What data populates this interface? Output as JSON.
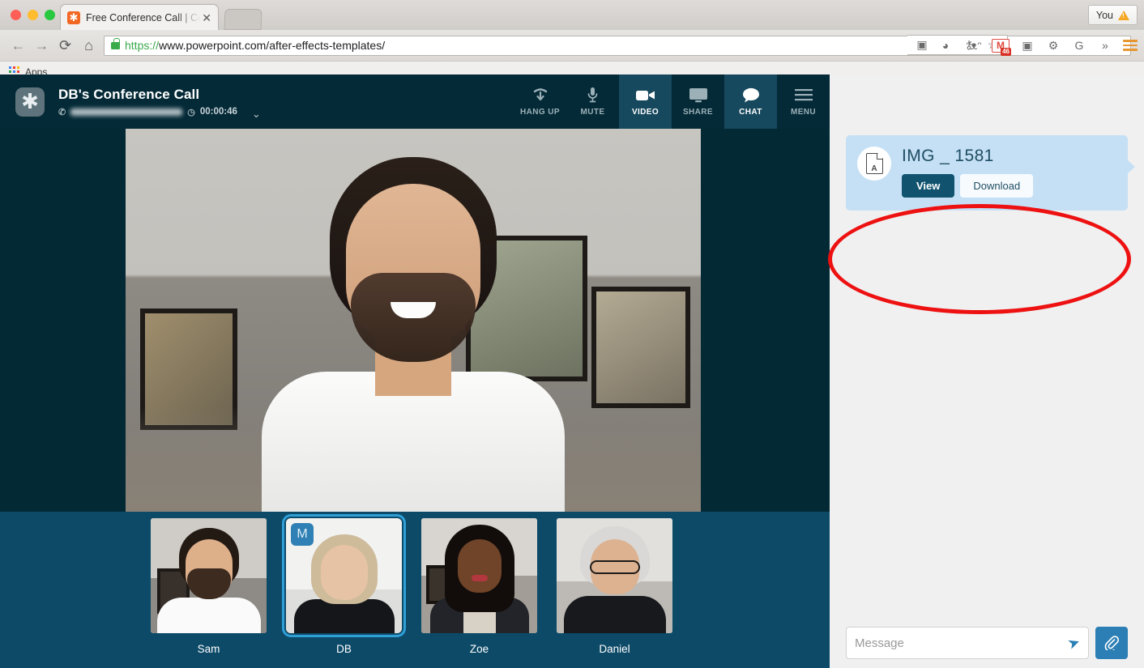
{
  "browser": {
    "tab": {
      "title": "Free Conference Call | Con",
      "favicon_icon": "asterisk-icon",
      "close_icon": "✕"
    },
    "window_controls": [
      "close",
      "minimize",
      "maximize"
    ],
    "profile_button": {
      "label": "You",
      "icon": "warning-triangle-icon"
    },
    "nav": {
      "back_icon": "←",
      "forward_icon": "→",
      "reload_icon": "⟳",
      "home_icon": "⌂"
    },
    "address": {
      "scheme": "https://",
      "rest": "www.powerpoint.com/after-effects-templates/",
      "lock_icon": "lock-icon"
    },
    "omni_icons": [
      "video-cast-icon",
      "profile-block-icon",
      "key-icon",
      "star-icon"
    ],
    "extensions": [
      {
        "name": "doodle-extension-icon",
        "glyph": "ᵔᴥᵔ"
      },
      {
        "name": "gmail-icon",
        "glyph": "M",
        "badge": "46"
      },
      {
        "name": "screenshot-extension-icon",
        "glyph": "▣"
      },
      {
        "name": "settings-gear-icon",
        "glyph": "⚙"
      },
      {
        "name": "google-icon",
        "glyph": "G"
      },
      {
        "name": "overflow-icon",
        "glyph": "»"
      },
      {
        "name": "chrome-menu-icon",
        "glyph": "≡"
      }
    ],
    "bookmarks": {
      "apps_label": "Apps"
    }
  },
  "app": {
    "logo_icon": "asterisk-logo-icon",
    "meeting_title": "DB's Conference Call",
    "phone_number": "",
    "phone_icon": "phone-icon",
    "timer_icon": "clock-icon",
    "timer": "00:00:46",
    "dropdown_icon": "chevron-down-icon",
    "toolbar": [
      {
        "label": "HANG UP",
        "icon": "hang-up-icon",
        "glyph": "⌁",
        "active": false
      },
      {
        "label": "MUTE",
        "icon": "microphone-icon",
        "glyph": "🎙",
        "active": false
      },
      {
        "label": "VIDEO",
        "icon": "video-camera-icon",
        "glyph": "▶",
        "active": true
      },
      {
        "label": "SHARE",
        "icon": "screen-share-icon",
        "glyph": "▭",
        "active": false
      },
      {
        "label": "CHAT",
        "icon": "chat-bubble-icon",
        "glyph": "💬",
        "active": true
      },
      {
        "label": "MENU",
        "icon": "hamburger-menu-icon",
        "glyph": "≡",
        "active": false
      }
    ],
    "participants": [
      {
        "name": "Sam",
        "selected": false,
        "badge": ""
      },
      {
        "name": "DB",
        "selected": true,
        "badge": "M"
      },
      {
        "name": "Zoe",
        "selected": false,
        "badge": ""
      },
      {
        "name": "Daniel",
        "selected": false,
        "badge": ""
      }
    ]
  },
  "chat": {
    "message": {
      "file_name": "IMG _ 1581",
      "file_type_icon": "pdf-file-icon",
      "view_label": "View",
      "download_label": "Download"
    },
    "composer": {
      "placeholder": "Message",
      "value": "",
      "send_icon": "send-paper-plane-icon",
      "attach_icon": "paperclip-icon"
    }
  },
  "annotation": {
    "shape": "red-ellipse-highlight",
    "color": "#ee1111"
  },
  "colors": {
    "app_dark": "#032935",
    "appbar": "#042a37",
    "tool_active": "#16485e",
    "filmstrip": "#0c4a68",
    "chat_bg": "#f0f0f0",
    "bubble": "#c5e0f5",
    "view_button": "#11536f",
    "accent_blue": "#2b7fb5",
    "annotation_red": "#ee1111"
  }
}
